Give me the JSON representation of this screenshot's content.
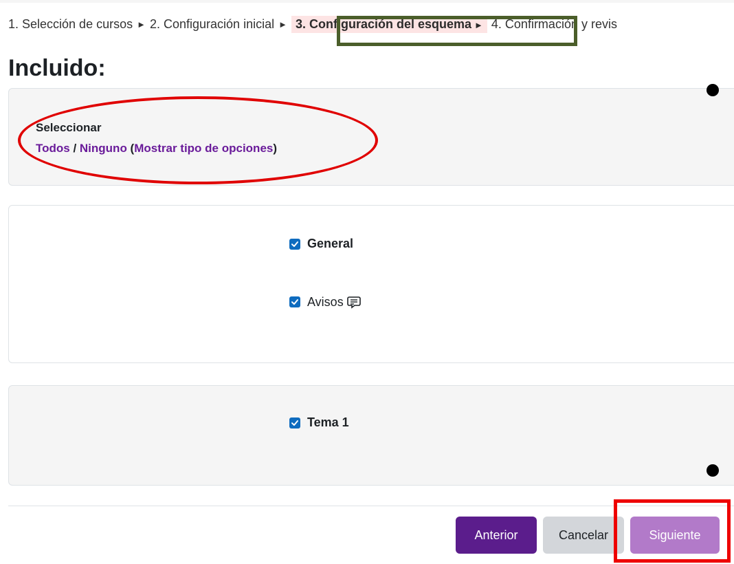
{
  "breadcrumb": {
    "steps": [
      "1. Selección de cursos",
      "2. Configuración inicial",
      "3. Configuración del esquema",
      "4. Confirmación y revis"
    ],
    "separator": "►"
  },
  "heading": "Incluido:",
  "select": {
    "label": "Seleccionar",
    "all": "Todos",
    "slash": " / ",
    "none": "Ninguno",
    "open_paren": " (",
    "show_types": "Mostrar tipo de opciones",
    "close_paren": ")"
  },
  "sections": {
    "general": {
      "label": "General",
      "checked": true
    },
    "avisos": {
      "label": "Avisos",
      "checked": true,
      "icon": "forum-icon"
    },
    "tema1": {
      "label": "Tema 1",
      "checked": true
    }
  },
  "buttons": {
    "previous": "Anterior",
    "cancel": "Cancelar",
    "next": "Siguiente"
  },
  "colors": {
    "link": "#6a1b9a",
    "primary": "#5b1d8c",
    "next": "#b27ac9",
    "checkbox": "#0f6cbf",
    "annotation_red": "#ee0000",
    "annotation_green": "#4b5e2a"
  }
}
